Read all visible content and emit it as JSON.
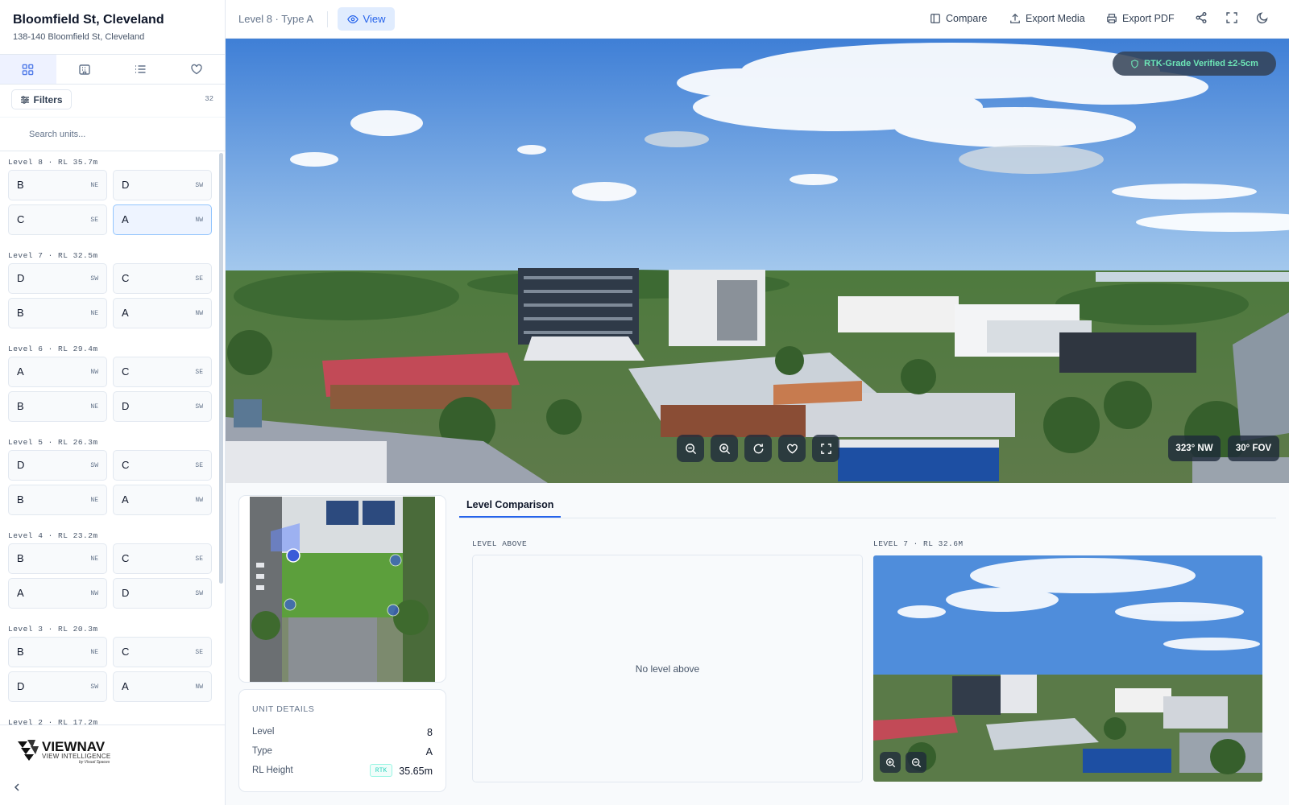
{
  "project": {
    "title": "Bloomfield St, Cleveland",
    "address": "138-140 Bloomfield St, Cleveland"
  },
  "sidebar": {
    "tabs": [
      {
        "name": "grid-icon",
        "active": true
      },
      {
        "name": "building-icon",
        "active": false
      },
      {
        "name": "list-icon",
        "active": false
      },
      {
        "name": "heart-icon",
        "active": false
      }
    ],
    "filters_label": "Filters",
    "unit_count": "32",
    "search_placeholder": "Search units...",
    "levels": [
      {
        "label": "Level 8 · RL 35.7m",
        "units": [
          {
            "type": "B",
            "dir": "NE"
          },
          {
            "type": "D",
            "dir": "SW"
          },
          {
            "type": "C",
            "dir": "SE"
          },
          {
            "type": "A",
            "dir": "NW",
            "selected": true
          }
        ]
      },
      {
        "label": "Level 7 · RL 32.5m",
        "units": [
          {
            "type": "D",
            "dir": "SW"
          },
          {
            "type": "C",
            "dir": "SE"
          },
          {
            "type": "B",
            "dir": "NE"
          },
          {
            "type": "A",
            "dir": "NW"
          }
        ]
      },
      {
        "label": "Level 6 · RL 29.4m",
        "units": [
          {
            "type": "A",
            "dir": "NW"
          },
          {
            "type": "C",
            "dir": "SE"
          },
          {
            "type": "B",
            "dir": "NE"
          },
          {
            "type": "D",
            "dir": "SW"
          }
        ]
      },
      {
        "label": "Level 5 · RL 26.3m",
        "units": [
          {
            "type": "D",
            "dir": "SW"
          },
          {
            "type": "C",
            "dir": "SE"
          },
          {
            "type": "B",
            "dir": "NE"
          },
          {
            "type": "A",
            "dir": "NW"
          }
        ]
      },
      {
        "label": "Level 4 · RL 23.2m",
        "units": [
          {
            "type": "B",
            "dir": "NE"
          },
          {
            "type": "C",
            "dir": "SE"
          },
          {
            "type": "A",
            "dir": "NW"
          },
          {
            "type": "D",
            "dir": "SW"
          }
        ]
      },
      {
        "label": "Level 3 · RL 20.3m",
        "units": [
          {
            "type": "B",
            "dir": "NE"
          },
          {
            "type": "C",
            "dir": "SE"
          },
          {
            "type": "D",
            "dir": "SW"
          },
          {
            "type": "A",
            "dir": "NW"
          }
        ]
      },
      {
        "label": "Level 2 · RL 17.2m",
        "units": []
      }
    ],
    "logo": {
      "brand": "VIEWNAV",
      "tagline": "VIEW INTELLIGENCE",
      "by": "by Visual Spaces"
    },
    "collapse_icon": "chevron-left-icon"
  },
  "topbar": {
    "breadcrumb": "Level 8 · Type A",
    "view_label": "View",
    "compare_label": "Compare",
    "export_media_label": "Export Media",
    "export_pdf_label": "Export PDF",
    "icons": [
      "share-icon",
      "fullscreen-icon",
      "moon-icon"
    ]
  },
  "viewer": {
    "badge": "RTK-Grade Verified ±2-5cm",
    "controls": [
      "zoom-out-icon",
      "zoom-in-icon",
      "rotate-icon",
      "heart-icon",
      "fullscreen-icon"
    ],
    "heading": "323° NW",
    "fov": "30° FOV"
  },
  "details": {
    "heading": "UNIT DETAILS",
    "rows": [
      {
        "label": "Level",
        "value": "8"
      },
      {
        "label": "Type",
        "value": "A"
      },
      {
        "label": "RL Height",
        "value": "35.65m",
        "chip": "RTK"
      }
    ]
  },
  "comparison": {
    "tab": "Level Comparison",
    "above_label": "LEVEL ABOVE",
    "above_empty": "No level above",
    "below_label": "LEVEL 7 · RL 32.6M",
    "controls": [
      "zoom-in-icon",
      "zoom-out-icon"
    ]
  },
  "colors": {
    "accent": "#2563eb",
    "rtk_green": "#6ee7b7",
    "selected_unit_bg": "#eef4ff"
  }
}
